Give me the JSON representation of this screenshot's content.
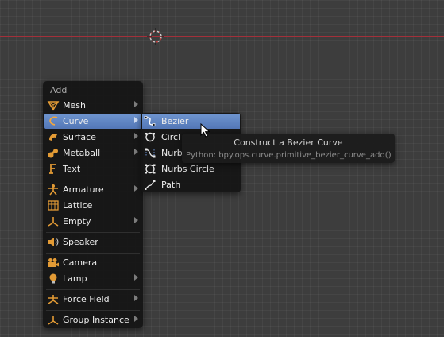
{
  "viewport": {
    "x_axis_color": "#a3303a",
    "y_axis_color": "#4f8f3a"
  },
  "add_menu": {
    "title": "Add",
    "items": [
      {
        "label": "Mesh",
        "icon": "mesh-icon",
        "has_submenu": true
      },
      {
        "label": "Curve",
        "icon": "curve-icon",
        "has_submenu": true,
        "active": true
      },
      {
        "label": "Surface",
        "icon": "surface-icon",
        "has_submenu": true
      },
      {
        "label": "Metaball",
        "icon": "metaball-icon",
        "has_submenu": true
      },
      {
        "label": "Text",
        "icon": "text-icon",
        "has_submenu": false
      },
      {
        "label": "Armature",
        "icon": "armature-icon",
        "has_submenu": true
      },
      {
        "label": "Lattice",
        "icon": "lattice-icon",
        "has_submenu": false
      },
      {
        "label": "Empty",
        "icon": "empty-icon",
        "has_submenu": true
      },
      {
        "label": "Speaker",
        "icon": "speaker-icon",
        "has_submenu": false
      },
      {
        "label": "Camera",
        "icon": "camera-icon",
        "has_submenu": false
      },
      {
        "label": "Lamp",
        "icon": "lamp-icon",
        "has_submenu": true
      },
      {
        "label": "Force Field",
        "icon": "force-field-icon",
        "has_submenu": true
      },
      {
        "label": "Group Instance",
        "icon": "group-instance-icon",
        "has_submenu": true
      }
    ]
  },
  "curve_submenu": {
    "items": [
      {
        "label": "Bezier",
        "icon": "bezier-curve-icon",
        "active": true
      },
      {
        "label": "Circl",
        "icon": "bezier-circle-icon"
      },
      {
        "label": "Nurb",
        "icon": "nurbs-curve-icon"
      },
      {
        "label": "Nurbs Circle",
        "icon": "nurbs-circle-icon"
      },
      {
        "label": "Path",
        "icon": "path-icon"
      }
    ]
  },
  "tooltip": {
    "title": "Construct a Bezier Curve",
    "python": "Python: bpy.ops.curve.primitive_bezier_curve_add()"
  },
  "colors": {
    "menu_bg": "#141414",
    "highlight": "#5f86c5",
    "icon_orange": "#e39b35"
  }
}
